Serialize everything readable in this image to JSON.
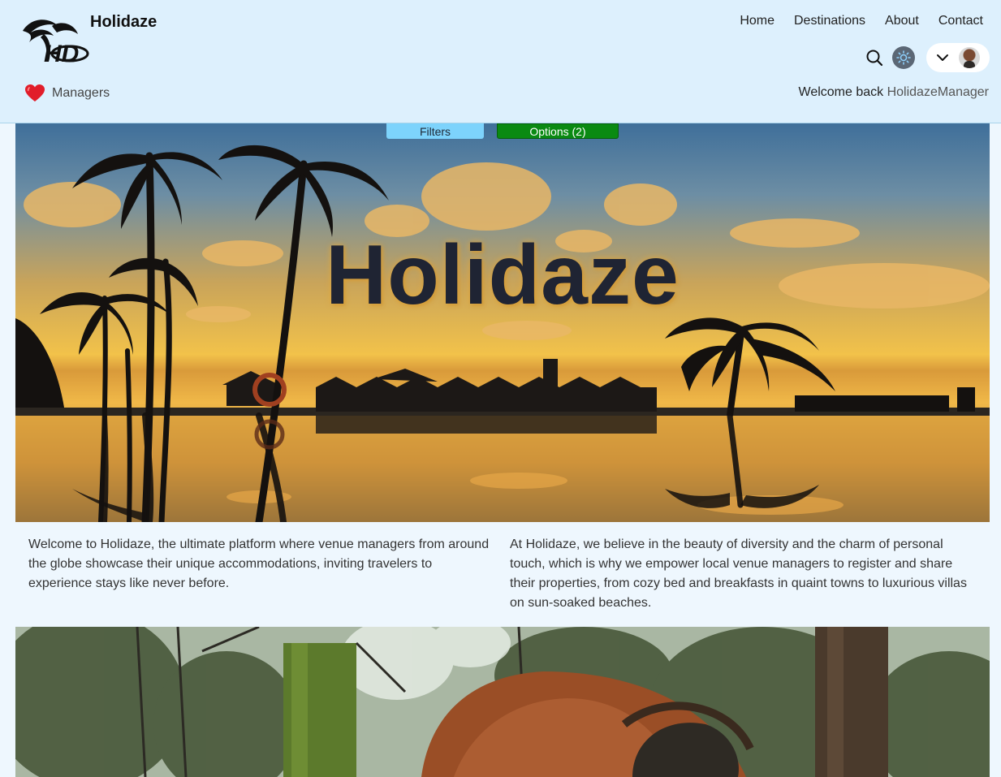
{
  "header": {
    "brand_name": "Holidaze",
    "logo_text": "HD",
    "managers_label": "Managers",
    "nav": [
      {
        "label": "Home"
      },
      {
        "label": "Destinations"
      },
      {
        "label": "About"
      },
      {
        "label": "Contact"
      }
    ],
    "welcome_prefix": "Welcome back",
    "username": "HolidazeManager"
  },
  "controls": {
    "filters_label": "Filters",
    "options_label": "Options (2)"
  },
  "hero": {
    "title": "Holidaze"
  },
  "intro": {
    "left": "Welcome to Holidaze, the ultimate platform where venue managers from around the globe showcase their unique accommodations, inviting travelers to experience stays like never before.",
    "right": "At Holidaze, we believe in the beauty of diversity and the charm of personal touch, which is why we empower local venue managers to register and share their properties, from cozy bed and breakfasts in quaint towns to luxurious villas on sun-soaked beaches."
  },
  "colors": {
    "header_bg": "#ddf0fd",
    "page_bg": "#eef7fe",
    "filters_bg": "#7dd3fc",
    "options_bg": "#0a8a12",
    "heart": "#e11d2a"
  },
  "icons": {
    "logo": "palm-tree-logo",
    "managers": "heart-icon",
    "search": "search-icon",
    "theme": "sun-icon",
    "menu": "chevron-down-icon"
  }
}
